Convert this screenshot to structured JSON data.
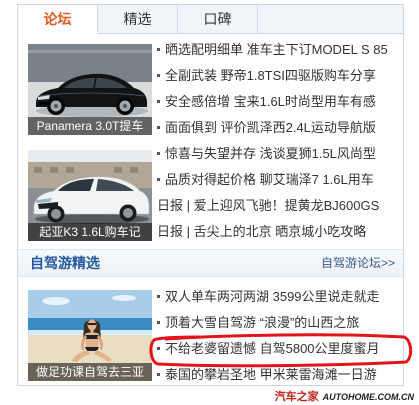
{
  "tabs": [
    {
      "label": "论坛",
      "active": true
    },
    {
      "label": "精选",
      "active": false
    },
    {
      "label": "口碑",
      "active": false
    }
  ],
  "forum": {
    "block1": {
      "caption": "Panamera 3.0T提车",
      "items": [
        "晒选配明细单 准车主下订MODEL S 85",
        "全副武装 野帝1.8TSI四驱版购车分享",
        "安全感倍增 宝来1.6L时尚型用车有感",
        "面面俱到 评价凯泽西2.4L运动导航版"
      ]
    },
    "block2": {
      "caption": "起亚K3 1.6L购车记",
      "items": [
        "惊喜与失望并存 浅谈夏狮1.5L风尚型",
        "品质对得起价格 聊艾瑞泽7 1.6L用车",
        "日报 | 爱上迎风飞驰！提黄龙BJ600GS",
        "日报 | 舌尖上的北京 晒京城小吃攻略"
      ]
    }
  },
  "selfdrive": {
    "title": "自驾游精选",
    "more_link": "自驾游论坛>>",
    "caption": "做足功课自驾去三亚",
    "items": [
      "双人单车两河两湖 3599公里说走就走",
      "顶着大雪自驾游 “浪漫”的山西之旅",
      "不给老婆留遗憾 自驾5800公里度蜜月",
      "泰国的攀岩圣地 甲米莱雷海滩一日游"
    ]
  },
  "annotation": {
    "circled_item_index": 2,
    "color": "#e3151b"
  },
  "watermark": {
    "brand": "汽车之家",
    "domain": "AUTOHOME.COM.CN"
  },
  "colors": {
    "active_tab": "#e25a1c",
    "section_title": "#24599f",
    "text": "#333333",
    "border": "#cdd8e4",
    "watermark_brand": "#c4251d"
  }
}
